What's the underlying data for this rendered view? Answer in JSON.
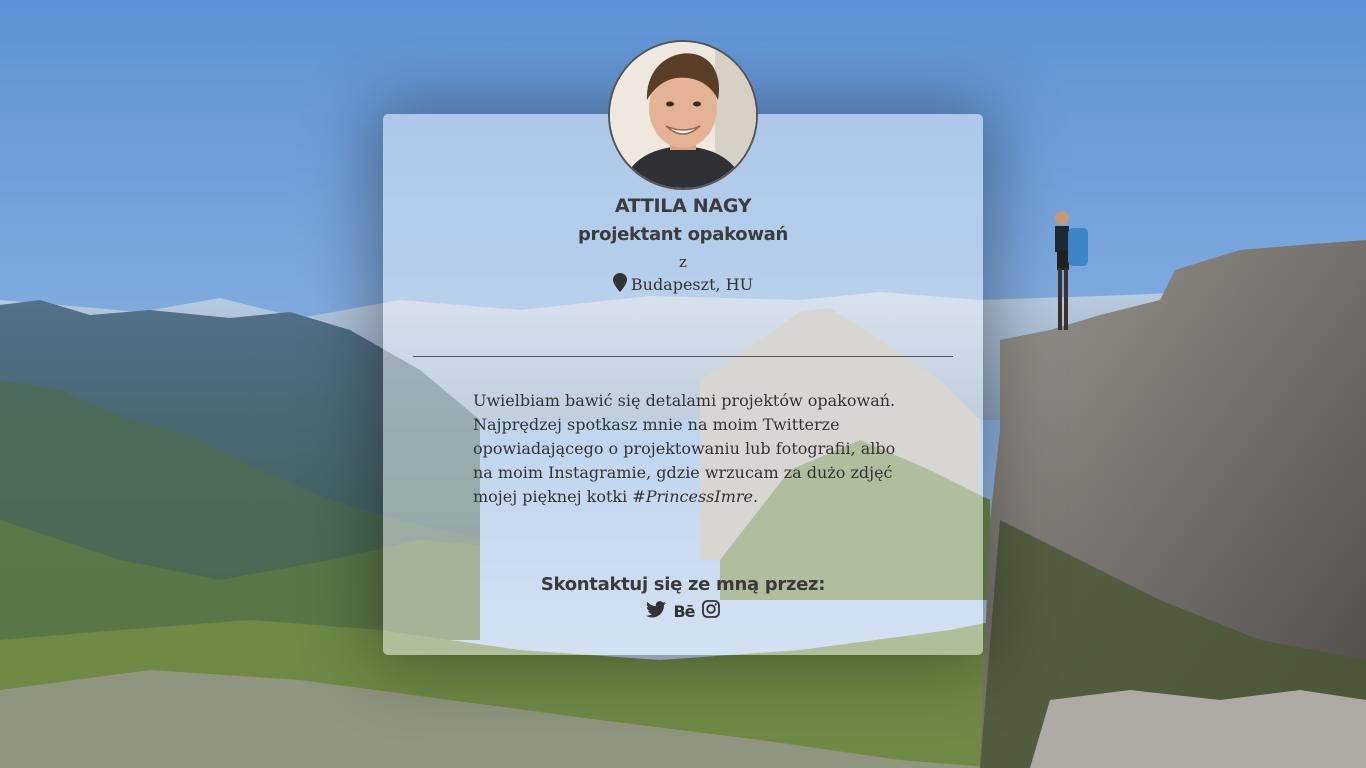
{
  "profile": {
    "name": "ATTILA NAGY",
    "role": "projektant opakowań",
    "from_label": "z",
    "location": "Budapeszt, HU",
    "location_icon": "map-marker-icon"
  },
  "bio": {
    "text": "Uwielbiam bawić się detalami projektów opakowań. Najprędzej spotkasz mnie na moim Twitterze opowiadającego o projektowaniu lub fotografii, albo na moim Instagramie, gdzie wrzucam za dużo zdjęć mojej pięknej kotki ",
    "hashtag": "#PrincessImre."
  },
  "contact": {
    "heading": "Skontaktuj się ze mną przez:",
    "links": [
      {
        "icon": "twitter-icon"
      },
      {
        "icon": "behance-icon",
        "label": "Bē"
      },
      {
        "icon": "instagram-icon"
      }
    ]
  },
  "colors": {
    "text": "#333333",
    "card_overlay": "rgba(255,255,255,0.45)"
  }
}
